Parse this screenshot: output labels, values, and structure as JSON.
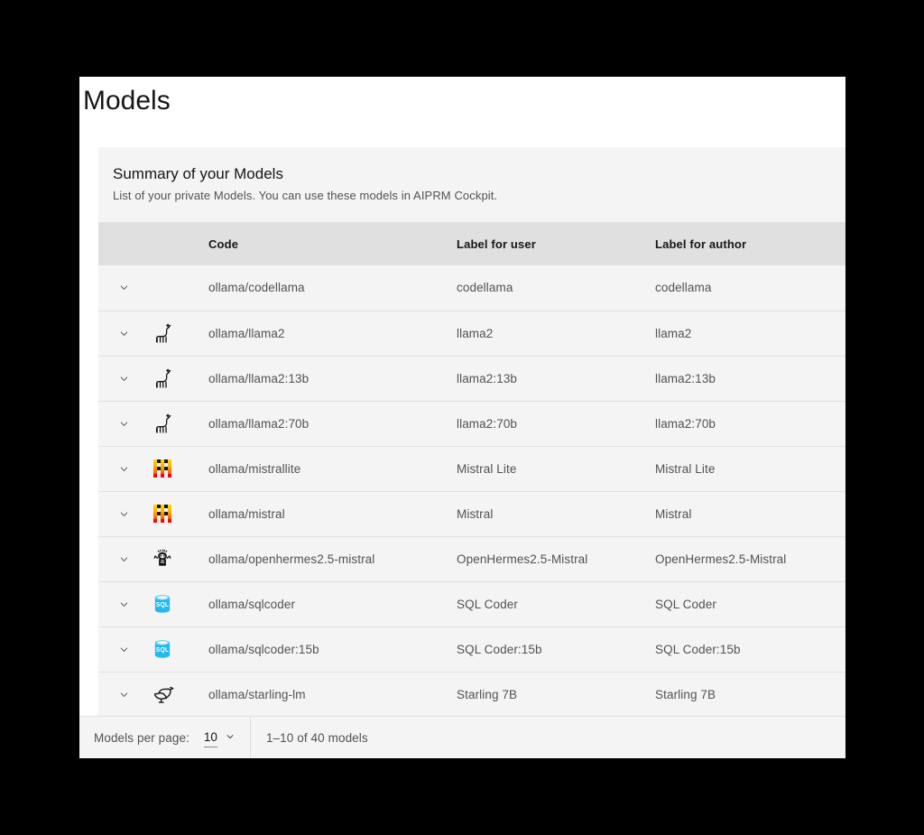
{
  "page": {
    "title": "Models"
  },
  "table": {
    "heading": "Summary of your Models",
    "description": "List of your private Models. You can use these models in AIPRM Cockpit.",
    "columns": {
      "expand": "",
      "icon": "",
      "code": "Code",
      "label_user": "Label for user",
      "label_author": "Label for author"
    },
    "rows": [
      {
        "icon": "none",
        "code": "ollama/codellama",
        "label_user": "codellama",
        "label_author": "codellama"
      },
      {
        "icon": "llama-icon",
        "code": "ollama/llama2",
        "label_user": "llama2",
        "label_author": "llama2"
      },
      {
        "icon": "llama-icon",
        "code": "ollama/llama2:13b",
        "label_user": "llama2:13b",
        "label_author": "llama2:13b"
      },
      {
        "icon": "llama-icon",
        "code": "ollama/llama2:70b",
        "label_user": "llama2:70b",
        "label_author": "llama2:70b"
      },
      {
        "icon": "mistral-icon",
        "code": "ollama/mistrallite",
        "label_user": "Mistral Lite",
        "label_author": "Mistral Lite"
      },
      {
        "icon": "mistral-icon",
        "code": "ollama/mistral",
        "label_user": "Mistral",
        "label_author": "Mistral"
      },
      {
        "icon": "hermes-icon",
        "code": "ollama/openhermes2.5-mistral",
        "label_user": "OpenHermes2.5-Mistral",
        "label_author": "OpenHermes2.5-Mistral"
      },
      {
        "icon": "sql-icon",
        "code": "ollama/sqlcoder",
        "label_user": "SQL Coder",
        "label_author": "SQL Coder"
      },
      {
        "icon": "sql-icon",
        "code": "ollama/sqlcoder:15b",
        "label_user": "SQL Coder:15b",
        "label_author": "SQL Coder:15b"
      },
      {
        "icon": "bird-icon",
        "code": "ollama/starling-lm",
        "label_user": "Starling 7B",
        "label_author": "Starling 7B"
      }
    ]
  },
  "pagination": {
    "per_page_label": "Models per page:",
    "per_page_value": "10",
    "range_text": "1–10 of 40 models"
  },
  "colors": {
    "panel_bg": "#ffffff",
    "row_bg": "#f4f4f4",
    "header_row_bg": "#e0e0e0",
    "border": "#e0e0e0",
    "text_primary": "#161616",
    "text_secondary": "#525252",
    "sql_icon": "#22b8f0",
    "mistral_yellow": "#ffd800",
    "mistral_orange": "#ff8205",
    "mistral_red": "#ff0107"
  }
}
